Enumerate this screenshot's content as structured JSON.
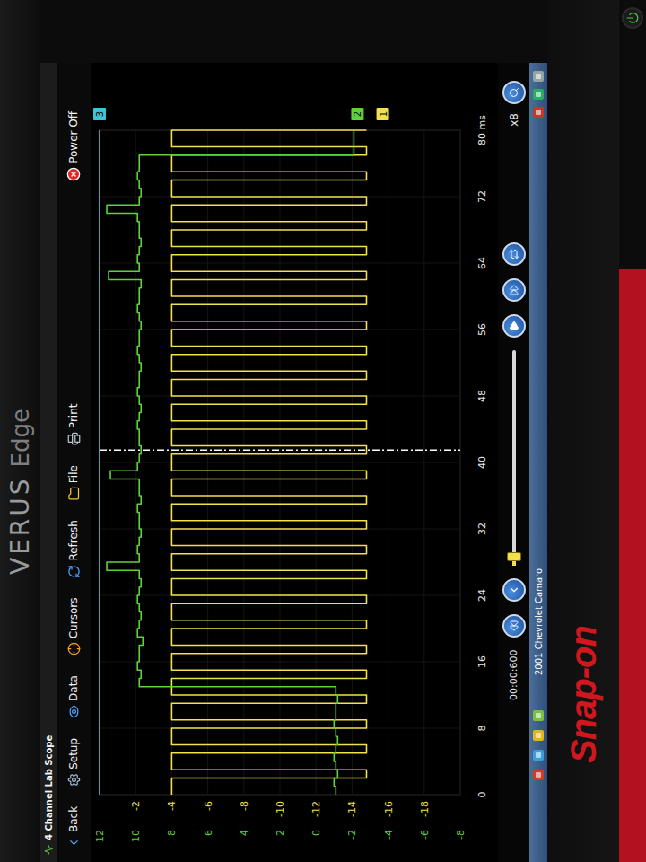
{
  "device": {
    "brand_top": "VERUS",
    "brand_top_sub": "Edge",
    "brand_bottom": "Snap-on"
  },
  "app": {
    "title": "4 Channel Lab Scope"
  },
  "toolbar": [
    {
      "label": "Back"
    },
    {
      "label": "Setup"
    },
    {
      "label": "Data"
    },
    {
      "label": "Cursors"
    },
    {
      "label": "Refresh"
    },
    {
      "label": "File"
    },
    {
      "label": "Print"
    }
  ],
  "power": {
    "label": "Power Off"
  },
  "chart": {
    "x_range": [
      0,
      80
    ],
    "y_range": [
      -8,
      12
    ],
    "cursor_ms": 41.5,
    "time_ticks": [
      "0",
      "8",
      "16",
      "24",
      "32",
      "40",
      "48",
      "56",
      "64",
      "72",
      "80 ms"
    ],
    "channels": [
      {
        "number": "1",
        "color": "#f2e14c",
        "offset": -3.7,
        "ticks": [
          "-2",
          "-4",
          "-6",
          "-8",
          "-10",
          "-12",
          "-14",
          "-16",
          "-18"
        ],
        "values": [
          8,
          8,
          -2.8,
          8,
          8,
          -2.8,
          8,
          8,
          -2.8,
          8,
          8,
          -2.8,
          8,
          8,
          -2.8,
          8,
          8,
          -2.8,
          8,
          8,
          -2.8,
          8,
          8,
          -2.8,
          8,
          8,
          -2.8,
          8,
          8,
          -2.8,
          8,
          8,
          -2.8,
          8,
          8,
          -2.8,
          8,
          8,
          -2.8,
          8,
          8,
          -2.8,
          8,
          8,
          -2.8,
          8,
          8,
          -2.8,
          8,
          8,
          -2.8,
          8,
          8,
          -2.8,
          8,
          8,
          -2.8,
          8,
          8,
          -2.8,
          8,
          8,
          -2.8,
          8,
          8,
          -2.8,
          8,
          8,
          -2.8,
          8,
          8,
          -2.8,
          8,
          8,
          -2.8,
          8,
          8,
          -2.8,
          8,
          8,
          -2.8
        ]
      },
      {
        "number": "2",
        "color": "#5fd23a",
        "offset": -2.3,
        "ticks": [
          "12",
          "10",
          "8",
          "6",
          "4",
          "2",
          "0",
          "-2",
          "-4",
          "-6",
          "-8"
        ],
        "values": [
          -1.1,
          -1.0,
          -1.2,
          -1.1,
          -1.0,
          -1.1,
          -1.2,
          -1.1,
          -1.0,
          -1.1,
          -1.1,
          -1.2,
          -1.1,
          9.8,
          9.7,
          9.9,
          9.8,
          9.8,
          9.6,
          9.9,
          9.8,
          9.7,
          9.8,
          9.9,
          9.8,
          9.7,
          9.8,
          11.6,
          9.8,
          9.9,
          9.8,
          9.7,
          9.8,
          9.8,
          9.9,
          9.7,
          9.8,
          9.8,
          11.4,
          9.9,
          9.8,
          9.7,
          9.8,
          9.8,
          9.9,
          9.8,
          9.7,
          9.8,
          9.9,
          9.8,
          9.8,
          9.7,
          9.8,
          9.9,
          9.8,
          9.8,
          9.7,
          9.8,
          9.9,
          9.8,
          9.8,
          9.7,
          11.5,
          9.8,
          9.9,
          9.8,
          9.7,
          9.8,
          9.8,
          9.9,
          11.6,
          9.8,
          9.7,
          9.8,
          9.9,
          9.8,
          9.8,
          -2.1,
          -2.1,
          -2.1,
          -2.1
        ]
      },
      {
        "number": "3",
        "color": "#39c6d6",
        "offset": 12,
        "ticks": [],
        "values": [
          12,
          12
        ]
      }
    ]
  },
  "playback": {
    "time": "00:00:600",
    "level": 0.02,
    "zoom": "x8"
  },
  "taskbar": {
    "vehicle": "2001 Chevrolet Camaro"
  }
}
